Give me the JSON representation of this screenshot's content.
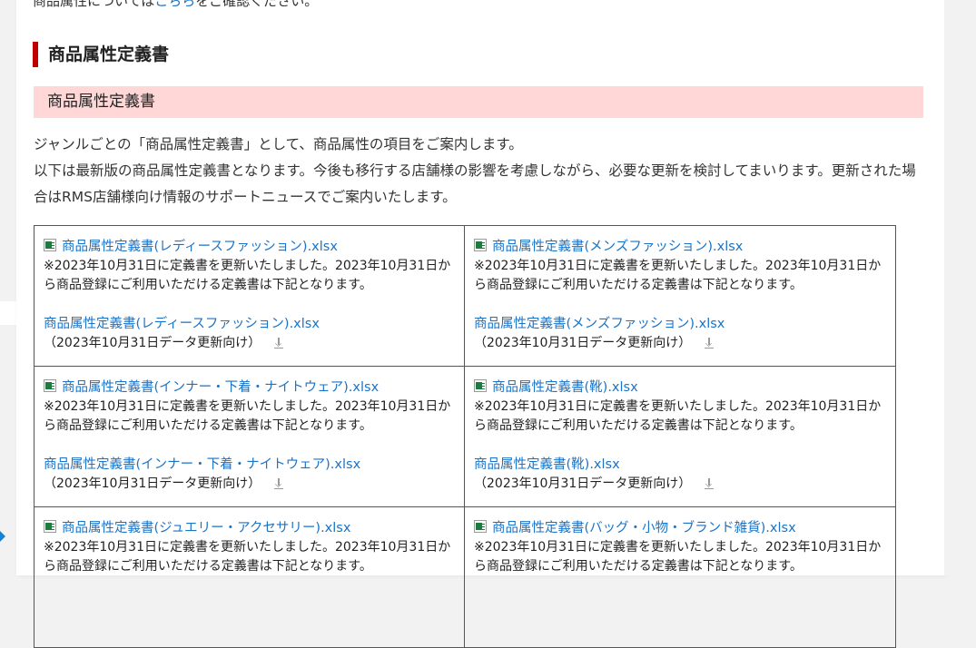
{
  "intro": {
    "prefix": "商品属性については",
    "link": "こちら",
    "suffix": "をご確認ください。"
  },
  "section_title": "商品属性定義書",
  "subheader": "商品属性定義書",
  "description": {
    "line1": "ジャンルごとの「商品属性定義書」として、商品属性の項目をご案内します。",
    "line2": "以下は最新版の商品属性定義書となります。今後も移行する店舗様の影響を考慮しながら、必要な更新を検討してまいります。更新された場合はRMS店舗様向け情報のサポートニュースでご案内いたします。"
  },
  "files": [
    {
      "title": "商品属性定義書(レディースファッション).xlsx",
      "note": "※2023年10月31日に定義書を更新いたしました。2023年10月31日から商品登録にご利用いただける定義書は下記となります。",
      "download": "商品属性定義書(レディースファッション).xlsx",
      "date_note": "（2023年10月31日データ更新向け）"
    },
    {
      "title": "商品属性定義書(メンズファッション).xlsx",
      "note": "※2023年10月31日に定義書を更新いたしました。2023年10月31日から商品登録にご利用いただける定義書は下記となります。",
      "download": "商品属性定義書(メンズファッション).xlsx",
      "date_note": "（2023年10月31日データ更新向け）"
    },
    {
      "title": "商品属性定義書(インナー・下着・ナイトウェア).xlsx",
      "note": "※2023年10月31日に定義書を更新いたしました。2023年10月31日から商品登録にご利用いただける定義書は下記となります。",
      "download": "商品属性定義書(インナー・下着・ナイトウェア).xlsx",
      "date_note": "（2023年10月31日データ更新向け）"
    },
    {
      "title": "商品属性定義書(靴).xlsx",
      "note": "※2023年10月31日に定義書を更新いたしました。2023年10月31日から商品登録にご利用いただける定義書は下記となります。",
      "download": "商品属性定義書(靴).xlsx",
      "date_note": "（2023年10月31日データ更新向け）"
    },
    {
      "title": "商品属性定義書(ジュエリー・アクセサリー).xlsx",
      "note": "※2023年10月31日に定義書を更新いたしました。2023年10月31日から商品登録にご利用いただける定義書は下記となります。",
      "download": "",
      "date_note": ""
    },
    {
      "title": "商品属性定義書(バッグ・小物・ブランド雑貨).xlsx",
      "note": "※2023年10月31日に定義書を更新いたしました。2023年10月31日から商品登録にご利用いただける定義書は下記となります。",
      "download": "",
      "date_note": ""
    }
  ],
  "colors": {
    "accent": "#bf0000",
    "link": "#1a73c7",
    "subheader_bg": "#ffd7d7"
  }
}
